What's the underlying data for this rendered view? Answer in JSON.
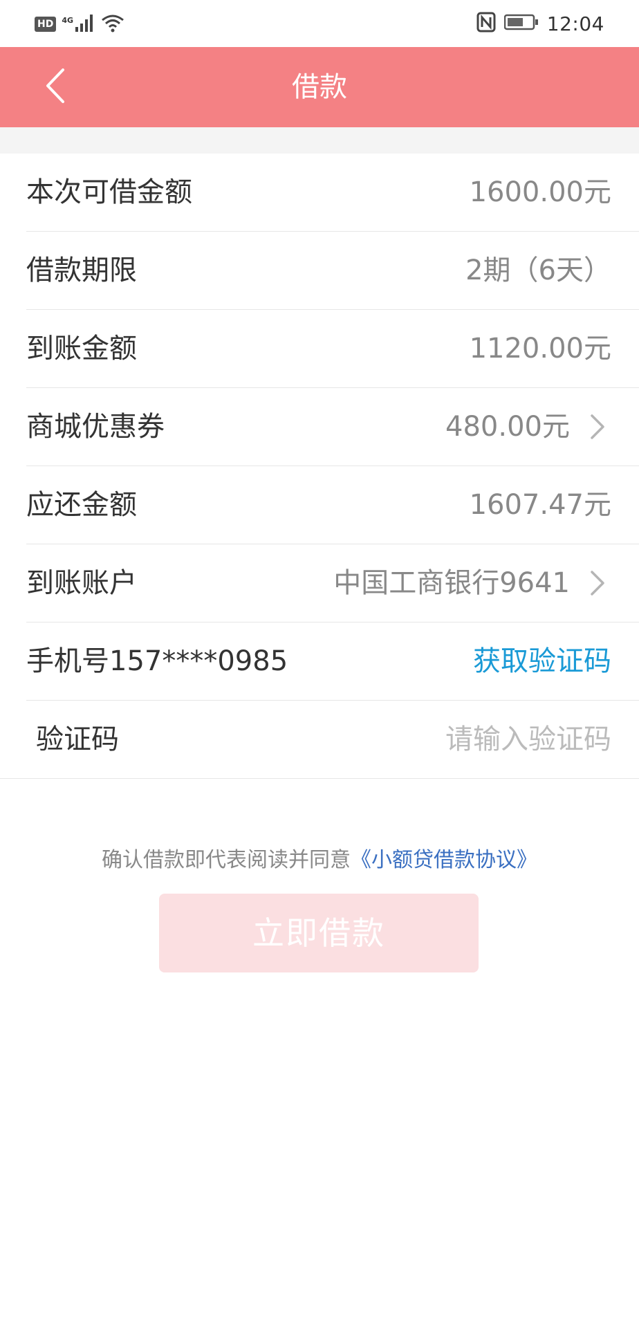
{
  "status_bar": {
    "hd": "HD",
    "network": "4G",
    "time": "12:04",
    "icons": [
      "signal-icon",
      "wifi-icon",
      "nfc-icon",
      "battery-icon"
    ]
  },
  "header": {
    "title": "借款",
    "background": "#f48184",
    "back_icon": "chevron-left-icon"
  },
  "form": {
    "rows": [
      {
        "label": "本次可借金额",
        "value": "1600.00元"
      },
      {
        "label": "借款期限",
        "value": "2期（6天）"
      },
      {
        "label": "到账金额",
        "value": "1120.00元"
      },
      {
        "label": "商城优惠券",
        "value": "480.00元"
      },
      {
        "label": "应还金额",
        "value": "1607.47元"
      },
      {
        "label": "到账账户",
        "value": "中国工商银行9641"
      },
      {
        "label": "手机号157****0985",
        "action": "获取验证码"
      }
    ],
    "code": {
      "label": "验证码",
      "value": "",
      "placeholder": "请输入验证码"
    }
  },
  "agreement": {
    "text": "确认借款即代表阅读并同意",
    "link": "《小额贷借款协议》"
  },
  "submit": {
    "label": "立即借款",
    "background": "#fbdfe1"
  },
  "colors": {
    "accent": "#f48184",
    "link_blue": "#1a9ad6",
    "agreement_link": "#3a6fc1"
  }
}
